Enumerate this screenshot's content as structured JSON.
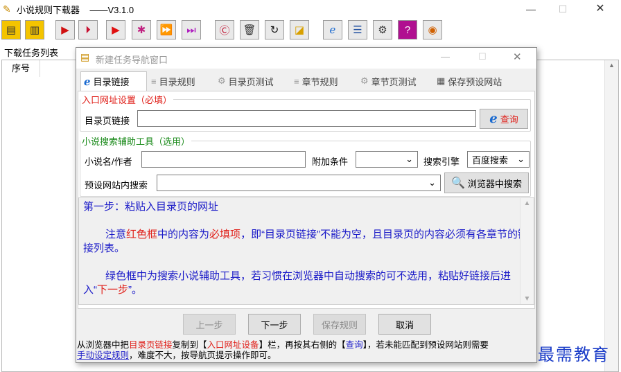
{
  "app": {
    "title": "小说规则下载器",
    "version": "——V3.1.0"
  },
  "window_controls": {
    "minimize": "—",
    "maximize": "☐",
    "close": "✕"
  },
  "toolbar": {
    "buttons": [
      "book-icon",
      "list-icon",
      "play-red-icon",
      "play-step-icon",
      "play-icon",
      "play-gear-icon",
      "play-double-icon",
      "fast-forward-icon",
      "refresh-c-icon",
      "trash-icon",
      "reload-icon",
      "folder-icon",
      "ie-icon",
      "notebook-icon",
      "gear-icon",
      "help-icon",
      "chat-icon"
    ]
  },
  "left": {
    "pane_title": "下载任务列表",
    "column_header": "序号"
  },
  "dialog": {
    "title": "新建任务导航窗口",
    "controls": {
      "minimize": "—",
      "maximize": "☐",
      "close": "✕"
    },
    "tabs": [
      {
        "label": "目录链接",
        "active": true
      },
      {
        "label": "目录规则"
      },
      {
        "label": "目录页测试"
      },
      {
        "label": "章节规则"
      },
      {
        "label": "章节页测试"
      },
      {
        "label": "保存预设网站"
      }
    ],
    "entry": {
      "legend": "入口网址设置（必填）",
      "url_label": "目录页链接",
      "url_value": "",
      "query_button": "查询"
    },
    "search": {
      "legend": "小说搜索辅助工具（选用）",
      "name_label": "小说名/作者",
      "name_value": "",
      "extra_label": "附加条件",
      "extra_value": "",
      "engine_label": "搜索引擎",
      "engine_value": "百度搜索",
      "preset_label": "预设网站内搜索",
      "preset_value": "",
      "browser_button": "浏览器中搜索"
    },
    "help": {
      "step": "第一步：粘贴入目录页的网址",
      "p1_a": "注意",
      "p1_b": "红色框",
      "p1_c": "中的内容为",
      "p1_d": "必填项",
      "p1_e": "，即“目录页链接”不能为空，且目录页的内容必须有各章节的链接列表。",
      "p2_a": "绿色框中为搜索小说辅助工具，若习惯在浏览器中自动搜索的可不选用，粘贴好链接后进入“",
      "p2_b": "下一步",
      "p2_c": "”。"
    },
    "buttons": {
      "prev": "上一步",
      "next": "下一步",
      "save": "保存规则",
      "cancel": "取消"
    },
    "status": {
      "s1": "从浏览器中把",
      "s2": "目录页链接",
      "s3": "复制到【",
      "s4": "入口网址设备",
      "s5": "】栏，再按其右侧的【",
      "s6": "查询",
      "s7": "】，若未能匹配到预设网站则需要",
      "s8": "手动设定规则",
      "s9": "，难度不大，按导航页提示操作即可。"
    }
  },
  "watermark": "最需教育"
}
